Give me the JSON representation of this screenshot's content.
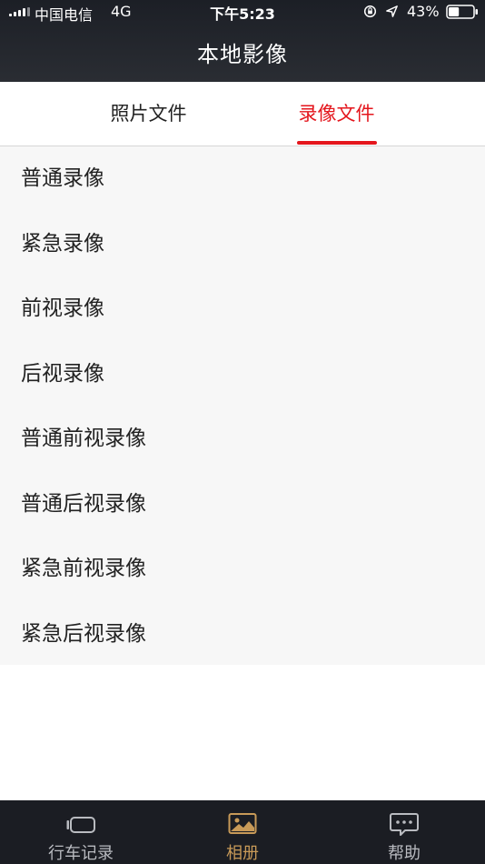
{
  "status_bar": {
    "carrier": "中国电信",
    "network": "4G",
    "time": "下午5:23",
    "battery": "43%",
    "battery_level": 0.43
  },
  "header": {
    "title": "本地影像"
  },
  "tabs": [
    {
      "label": "照片文件",
      "active": false
    },
    {
      "label": "录像文件",
      "active": true
    }
  ],
  "video_categories": [
    "普通录像",
    "紧急录像",
    "前视录像",
    "后视录像",
    "普通前视录像",
    "普通后视录像",
    "紧急前视录像",
    "紧急后视录像"
  ],
  "bottom_nav": [
    {
      "label": "行车记录",
      "icon": "dashcam-icon",
      "active": false
    },
    {
      "label": "相册",
      "icon": "album-icon",
      "active": true
    },
    {
      "label": "帮助",
      "icon": "help-chat-icon",
      "active": false
    }
  ],
  "colors": {
    "accent_red": "#e4161d",
    "active_gold": "#c89a58",
    "bar_dark": "#1b1d23"
  }
}
